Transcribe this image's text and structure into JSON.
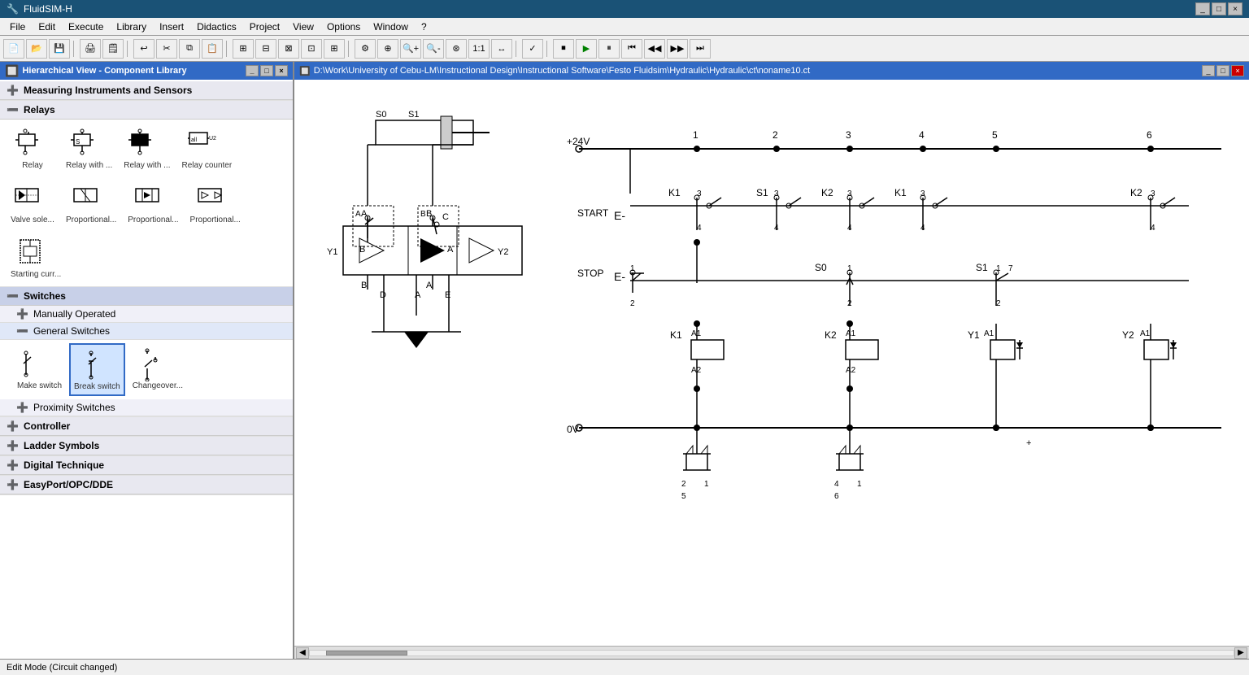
{
  "app": {
    "title": "FluidSIM-H",
    "icon": "🔧"
  },
  "titlebar": {
    "title": "FluidSIM-H",
    "controls": [
      "_",
      "□",
      "×"
    ]
  },
  "menubar": {
    "items": [
      "File",
      "Edit",
      "Execute",
      "Library",
      "Insert",
      "Didactics",
      "Project",
      "View",
      "Options",
      "Window",
      "?"
    ]
  },
  "canvas_titlebar": {
    "path": "D:\\Work\\University of Cebu-LM\\Instructional Design\\Instructional Software\\Festo Fluidsim\\Hydraulic\\Hydraulic\\ct\\noname10.ct",
    "controls": [
      "_",
      "□",
      "×"
    ]
  },
  "left_panel": {
    "title": "Hierarchical View - Component Library",
    "controls": [
      "_",
      "□",
      "×"
    ]
  },
  "tree": {
    "sections": [
      {
        "id": "measuring",
        "label": "Measuring Instruments and Sensors",
        "expanded": false,
        "indent": 1
      },
      {
        "id": "relays",
        "label": "Relays",
        "expanded": true,
        "indent": 0,
        "components": [
          {
            "label": "Relay",
            "icon": "relay"
          },
          {
            "label": "Relay with ...",
            "icon": "relay_s"
          },
          {
            "label": "Relay with ...",
            "icon": "relay_b"
          },
          {
            "label": "Relay counter",
            "icon": "relay_c"
          },
          {
            "label": "Valve sole...",
            "icon": "valve_sole"
          },
          {
            "label": "Proportional...",
            "icon": "prop1"
          },
          {
            "label": "Proportional...",
            "icon": "prop2"
          },
          {
            "label": "Proportional...",
            "icon": "prop3"
          },
          {
            "label": "Starting curr...",
            "icon": "starting"
          }
        ]
      },
      {
        "id": "switches",
        "label": "Switches",
        "expanded": true,
        "indent": 0,
        "subsections": [
          {
            "id": "manually_operated",
            "label": "Manually Operated",
            "expanded": false
          },
          {
            "id": "general_switches",
            "label": "General Switches",
            "expanded": true,
            "components": [
              {
                "label": "Make switch",
                "icon": "make_switch"
              },
              {
                "label": "Break switch",
                "icon": "break_switch",
                "selected": true
              },
              {
                "label": "Changeover...",
                "icon": "changeover"
              }
            ]
          },
          {
            "id": "proximity_switches",
            "label": "Proximity Switches",
            "expanded": false
          }
        ]
      },
      {
        "id": "controller",
        "label": "Controller",
        "expanded": false,
        "indent": 0
      },
      {
        "id": "ladder",
        "label": "Ladder Symbols",
        "expanded": false,
        "indent": 0
      },
      {
        "id": "digital",
        "label": "Digital Technique",
        "expanded": false,
        "indent": 0
      },
      {
        "id": "easyport",
        "label": "EasyPort/OPC/DDE",
        "expanded": false,
        "indent": 0
      }
    ]
  },
  "status": {
    "text": "Edit Mode (Circuit changed)"
  }
}
